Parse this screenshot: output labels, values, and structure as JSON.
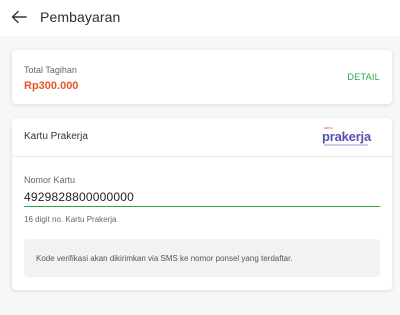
{
  "header": {
    "back_icon": "arrow-left-icon",
    "title": "Pembayaran"
  },
  "total": {
    "label": "Total Tagihan",
    "amount": "Rp300.000",
    "detail_link": "DETAIL",
    "amount_color": "#e8572a",
    "link_color": "#28a745"
  },
  "kartu": {
    "title": "Kartu Prakerja",
    "logo": {
      "small_text": "kartu",
      "main_text": "prakerja"
    },
    "nomor_label": "Nomor Kartu",
    "nomor_value": "4929828800000000",
    "helper_text": "16 digit no. Kartu Prakerja",
    "info_text": "Kode verifikasi akan dikirimkan via SMS ke nomor ponsel yang terdaftar."
  }
}
